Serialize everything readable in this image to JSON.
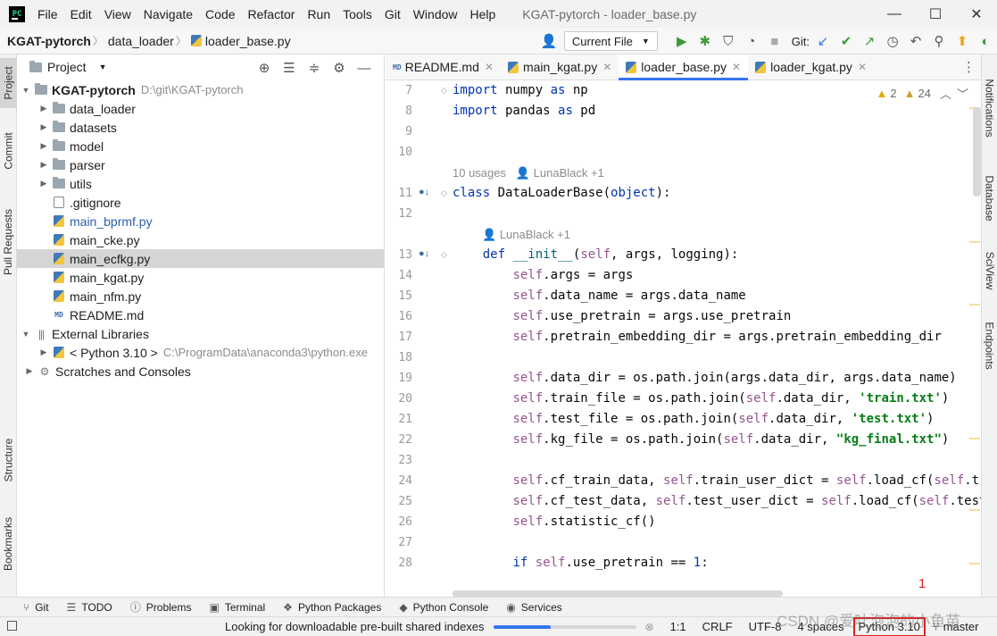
{
  "menubar": {
    "items": [
      "File",
      "Edit",
      "View",
      "Navigate",
      "Code",
      "Refactor",
      "Run",
      "Tools",
      "Git",
      "Window",
      "Help"
    ],
    "window_title": "KGAT-pytorch - loader_base.py",
    "minimize": "—",
    "maximize": "☐",
    "close": "✕"
  },
  "breadcrumb": {
    "root": "KGAT-pytorch",
    "folder": "data_loader",
    "file": "loader_base.py"
  },
  "toolbar": {
    "run_config": "Current File",
    "git_label": "Git:"
  },
  "left_strip": {
    "project": "Project",
    "commit": "Commit",
    "pull_requests": "Pull Requests",
    "structure": "Structure",
    "bookmarks": "Bookmarks"
  },
  "right_strip": {
    "notifications": "Notifications",
    "database": "Database",
    "sciview": "SciView",
    "endpoints": "Endpoints"
  },
  "project_panel": {
    "title": "Project",
    "root_name": "KGAT-pytorch",
    "root_path": "D:\\git\\KGAT-pytorch",
    "items": [
      {
        "label": "data_loader"
      },
      {
        "label": "datasets"
      },
      {
        "label": "model"
      },
      {
        "label": "parser"
      },
      {
        "label": "utils"
      },
      {
        "label": ".gitignore"
      },
      {
        "label": "main_bprmf.py"
      },
      {
        "label": "main_cke.py"
      },
      {
        "label": "main_ecfkg.py"
      },
      {
        "label": "main_kgat.py"
      },
      {
        "label": "main_nfm.py"
      },
      {
        "label": "README.md"
      }
    ],
    "external_libraries": "External Libraries",
    "python_sdk": "< Python 3.10 >",
    "python_path": "C:\\ProgramData\\anaconda3\\python.exe",
    "scratches": "Scratches and Consoles"
  },
  "editor": {
    "tabs": [
      {
        "label": "README.md",
        "icon": "MD"
      },
      {
        "label": "main_kgat.py"
      },
      {
        "label": "loader_base.py"
      },
      {
        "label": "loader_kgat.py"
      }
    ],
    "inspection": {
      "warnings": "2",
      "weak_warnings": "24"
    },
    "hints": {
      "class_usages": "10 usages",
      "class_author": "LunaBlack +1",
      "init_author": "LunaBlack +1"
    },
    "line_numbers": [
      "7",
      "8",
      "9",
      "10",
      "11",
      "12",
      "13",
      "14",
      "15",
      "16",
      "17",
      "18",
      "19",
      "20",
      "21",
      "22",
      "23",
      "24",
      "25",
      "26",
      "27",
      "28"
    ],
    "code": {
      "l7_kw": "import",
      "l7_rest": " numpy ",
      "l7_kw2": "as",
      "l7_rest2": " np",
      "l8_kw": "import",
      "l8_rest": " pandas ",
      "l8_kw2": "as",
      "l8_rest2": " pd",
      "l11_kw": "class",
      "l11_rest": " DataLoaderBase(",
      "l11_obj": "object",
      "l11_end": "):",
      "l13_kw": "def",
      "l13_fn": "__init__",
      "l13_open": "(",
      "l13_self": "self",
      "l13_rest": ", args, logging):",
      "l14": ".args = args",
      "l15": ".data_name = args.data_name",
      "l16": ".use_pretrain = args.use_pretrain",
      "l17": ".pretrain_embedding_dir = args.pretrain_embedding_dir",
      "l19": ".data_dir = os.path.join(args.data_dir, args.data_name)",
      "l20_a": ".train_file = os.path.join(",
      "l20_b": ".data_dir, ",
      "l20_str": "'train.txt'",
      "l20_end": ")",
      "l21_a": ".test_file = os.path.join(",
      "l21_b": ".data_dir, ",
      "l21_str": "'test.txt'",
      "l21_end": ")",
      "l22_a": ".kg_file = os.path.join(",
      "l22_b": ".data_dir, ",
      "l22_str": "\"kg_final.txt\"",
      "l22_end": ")",
      "l24_a": ".cf_train_data, ",
      "l24_b": ".train_user_dict = ",
      "l24_c": ".load_cf(",
      "l24_d": ".tr",
      "l25_a": ".cf_test_data, ",
      "l25_b": ".test_user_dict = ",
      "l25_c": ".load_cf(",
      "l25_d": ".test",
      "l26": ".statistic_cf()",
      "l28_kw": "if",
      "l28_rest": ".use_pretrain == ",
      "l28_num": "1",
      "l28_end": ":",
      "self": "self"
    }
  },
  "bottom_tools": [
    {
      "label": "Git",
      "icon": "git-icon"
    },
    {
      "label": "TODO",
      "icon": "list-icon"
    },
    {
      "label": "Problems",
      "icon": "info-icon"
    },
    {
      "label": "Terminal",
      "icon": "terminal-icon"
    },
    {
      "label": "Python Packages",
      "icon": "packages-icon"
    },
    {
      "label": "Python Console",
      "icon": "python-icon"
    },
    {
      "label": "Services",
      "icon": "services-icon"
    }
  ],
  "statusbar": {
    "message": "Looking for downloadable pre-built shared indexes",
    "progress": 0.4,
    "position": "1:1",
    "line_sep": "CRLF",
    "encoding": "UTF-8",
    "indent": "4 spaces",
    "interpreter": "Python 3.10",
    "branch": "master"
  },
  "annotation": {
    "number": "1"
  },
  "watermark": "CSDN @爱吐泡泡的小鱼苗",
  "colors": {
    "accent": "#3574f0",
    "keyword": "#0033b3",
    "self": "#94558d",
    "string": "#067d17",
    "annotation": "#e02020"
  }
}
